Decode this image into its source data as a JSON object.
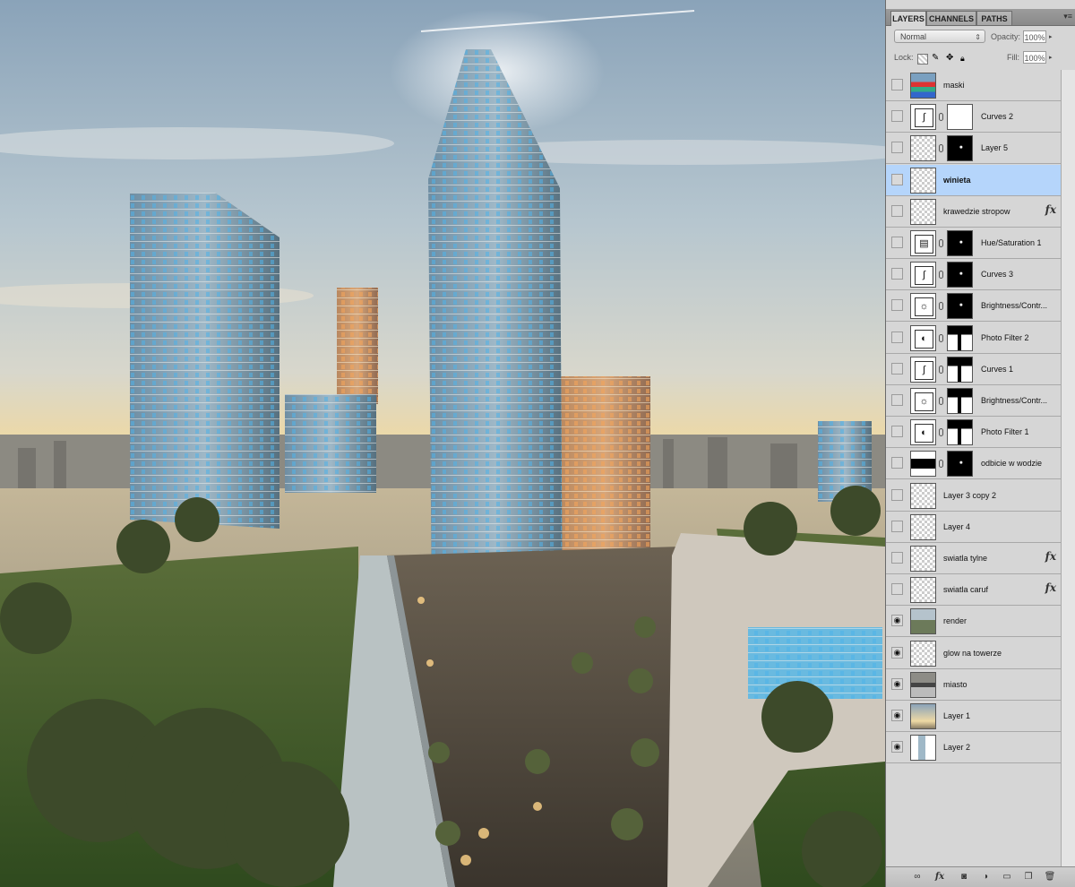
{
  "panel": {
    "tabs": [
      "LAYERS",
      "CHANNELS",
      "PATHS"
    ],
    "blend_mode": "Normal",
    "opacity_label": "Opacity:",
    "opacity_value": "100%",
    "lock_label": "Lock:",
    "fill_label": "Fill:",
    "fill_value": "100%"
  },
  "layers": [
    {
      "name": "maski",
      "visible": false,
      "thumb": "image-colorful",
      "mask": null,
      "fx": false,
      "selected": false
    },
    {
      "name": "Curves 2",
      "visible": false,
      "thumb": "curves-adjustment",
      "mask": "white",
      "fx": false,
      "selected": false
    },
    {
      "name": "Layer 5",
      "visible": false,
      "thumb": "transparent-spot",
      "mask": "black-dots",
      "fx": false,
      "selected": false
    },
    {
      "name": "winieta",
      "visible": false,
      "thumb": "transparent",
      "mask": null,
      "fx": false,
      "selected": true
    },
    {
      "name": "krawedzie stropow",
      "visible": false,
      "thumb": "transparent",
      "mask": null,
      "fx": true,
      "selected": false
    },
    {
      "name": "Hue/Saturation 1",
      "visible": false,
      "thumb": "hue-saturation-adjustment",
      "mask": "black-dots",
      "fx": false,
      "selected": false
    },
    {
      "name": "Curves 3",
      "visible": false,
      "thumb": "curves-adjustment",
      "mask": "black-dots",
      "fx": false,
      "selected": false
    },
    {
      "name": "Brightness/Contr...",
      "visible": false,
      "thumb": "brightness-adjustment",
      "mask": "black-dots",
      "fx": false,
      "selected": false
    },
    {
      "name": "Photo Filter 2",
      "visible": false,
      "thumb": "photo-filter-adjustment",
      "mask": "skyline",
      "fx": false,
      "selected": false
    },
    {
      "name": "Curves 1",
      "visible": false,
      "thumb": "curves-adjustment",
      "mask": "skyline",
      "fx": false,
      "selected": false
    },
    {
      "name": "Brightness/Contr...",
      "visible": false,
      "thumb": "brightness-adjustment",
      "mask": "skyline",
      "fx": false,
      "selected": false
    },
    {
      "name": "Photo Filter 1",
      "visible": false,
      "thumb": "photo-filter-adjustment",
      "mask": "skyline",
      "fx": false,
      "selected": false
    },
    {
      "name": "odbicie w wodzie",
      "visible": false,
      "thumb": "black-band",
      "mask": "black-dots",
      "fx": false,
      "selected": false
    },
    {
      "name": "Layer 3 copy 2",
      "visible": false,
      "thumb": "transparent",
      "mask": null,
      "fx": false,
      "selected": false
    },
    {
      "name": "Layer 4",
      "visible": false,
      "thumb": "transparent",
      "mask": null,
      "fx": false,
      "selected": false
    },
    {
      "name": "swiatla tylne",
      "visible": false,
      "thumb": "transparent",
      "mask": null,
      "fx": true,
      "selected": false
    },
    {
      "name": "swiatla caruf",
      "visible": false,
      "thumb": "transparent",
      "mask": null,
      "fx": true,
      "selected": false
    },
    {
      "name": "render",
      "visible": true,
      "thumb": "image-render",
      "mask": null,
      "fx": false,
      "selected": false
    },
    {
      "name": "glow na towerze",
      "visible": true,
      "thumb": "transparent",
      "mask": null,
      "fx": false,
      "selected": false
    },
    {
      "name": "miasto",
      "visible": true,
      "thumb": "image-city",
      "mask": null,
      "fx": false,
      "selected": false
    },
    {
      "name": "Layer 1",
      "visible": true,
      "thumb": "image-sky",
      "mask": null,
      "fx": false,
      "selected": false
    },
    {
      "name": "Layer 2",
      "visible": true,
      "thumb": "image-towers",
      "mask": null,
      "fx": false,
      "selected": false
    }
  ],
  "bottom_icons": [
    "link-layers-icon",
    "layer-style-fx-icon",
    "add-mask-icon",
    "adjustment-layer-icon",
    "new-group-icon",
    "new-layer-icon",
    "trash-icon"
  ],
  "colors": {
    "selected_row": "#b5d5fb",
    "panel_bg": "#d6d6d6"
  }
}
